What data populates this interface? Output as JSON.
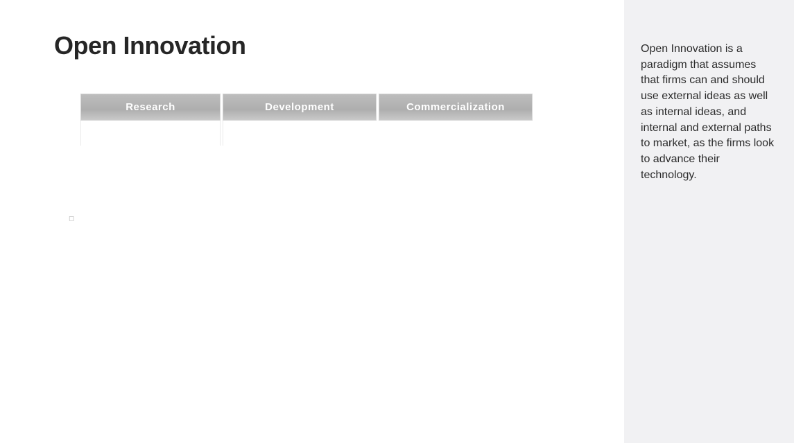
{
  "title": "Open Innovation",
  "stages": [
    {
      "label": "Research"
    },
    {
      "label": "Development"
    },
    {
      "label": "Commercialization"
    }
  ],
  "sidebar": {
    "description": "Open Innovation is a paradigm that assumes that firms can and should use external ideas as well as internal ideas, and internal and external paths to market, as the firms look to advance their technology."
  },
  "colors": {
    "sidebar_bg": "#f1f1f3",
    "stage_header_bg": "#b3b3b3",
    "title_color": "#262626"
  }
}
